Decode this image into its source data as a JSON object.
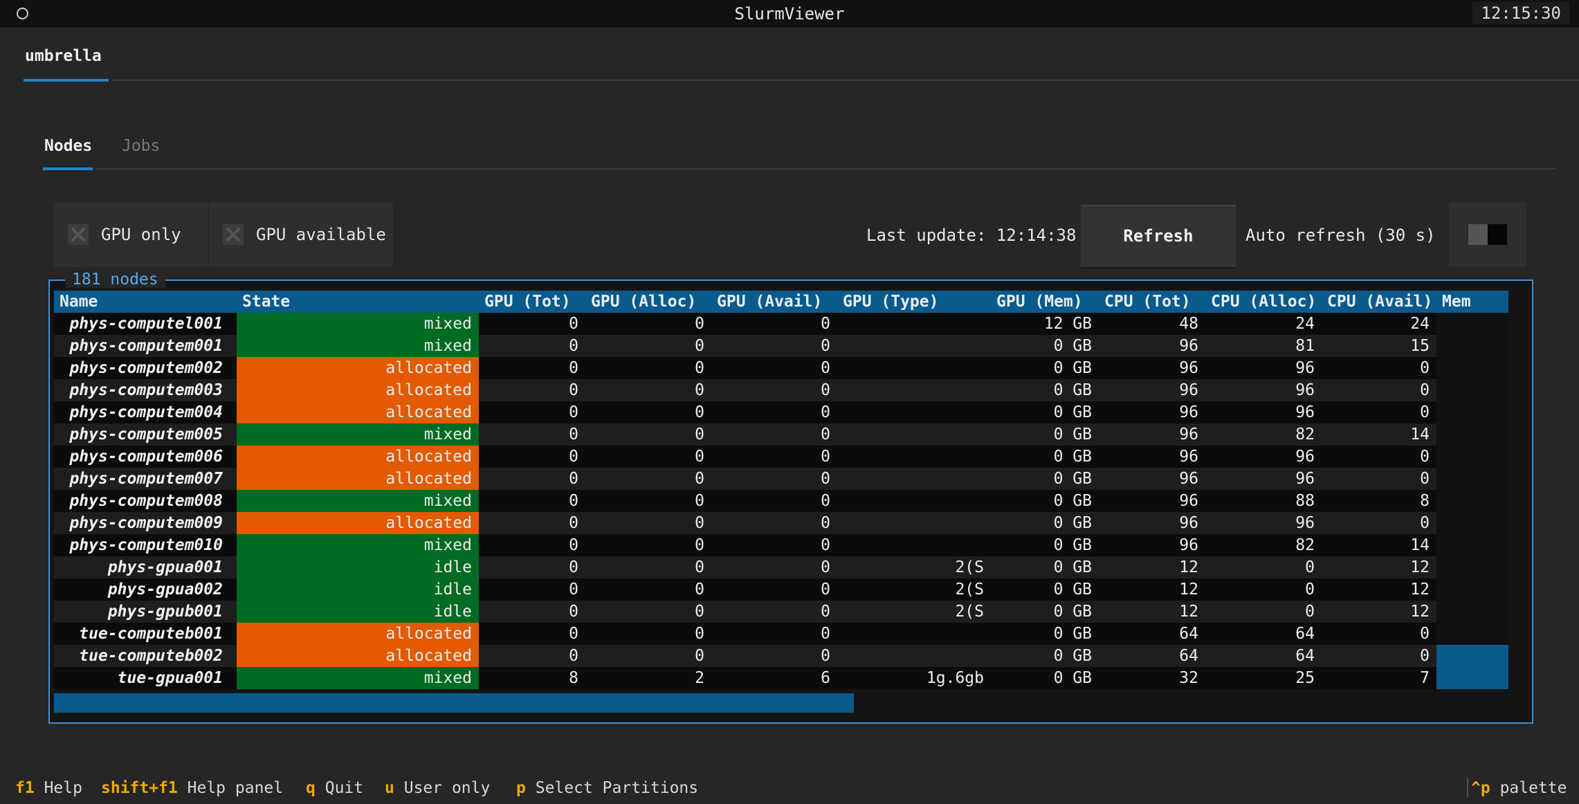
{
  "window": {
    "title": "SlurmViewer",
    "clock": "12:15:30"
  },
  "outer_tab": {
    "label": "umbrella"
  },
  "inner_tabs": [
    {
      "label": "Nodes",
      "active": true
    },
    {
      "label": "Jobs",
      "active": false
    }
  ],
  "toolbar": {
    "gpu_only_label": "GPU only",
    "gpu_available_label": "GPU available",
    "last_update": "Last update: 12:14:38",
    "refresh_label": "Refresh",
    "auto_refresh_label": "Auto refresh (30 s)",
    "auto_refresh_on": false
  },
  "panel": {
    "title": "181 nodes"
  },
  "table": {
    "columns": [
      "Name",
      "State",
      "GPU (Tot)",
      "GPU (Alloc)",
      "GPU (Avail)",
      "GPU (Type)",
      "GPU (Mem)",
      "CPU (Tot)",
      "CPU (Alloc)",
      "CPU (Avail)",
      "Mem"
    ],
    "rows": [
      [
        "phys-computel001",
        "mixed",
        "0",
        "0",
        "0",
        "",
        "12 GB",
        "48",
        "24",
        "24"
      ],
      [
        "phys-computem001",
        "mixed",
        "0",
        "0",
        "0",
        "",
        "0 GB",
        "96",
        "81",
        "15"
      ],
      [
        "phys-computem002",
        "allocated",
        "0",
        "0",
        "0",
        "",
        "0 GB",
        "96",
        "96",
        "0"
      ],
      [
        "phys-computem003",
        "allocated",
        "0",
        "0",
        "0",
        "",
        "0 GB",
        "96",
        "96",
        "0"
      ],
      [
        "phys-computem004",
        "allocated",
        "0",
        "0",
        "0",
        "",
        "0 GB",
        "96",
        "96",
        "0"
      ],
      [
        "phys-computem005",
        "mixed",
        "0",
        "0",
        "0",
        "",
        "0 GB",
        "96",
        "82",
        "14"
      ],
      [
        "phys-computem006",
        "allocated",
        "0",
        "0",
        "0",
        "",
        "0 GB",
        "96",
        "96",
        "0"
      ],
      [
        "phys-computem007",
        "allocated",
        "0",
        "0",
        "0",
        "",
        "0 GB",
        "96",
        "96",
        "0"
      ],
      [
        "phys-computem008",
        "mixed",
        "0",
        "0",
        "0",
        "",
        "0 GB",
        "96",
        "88",
        "8"
      ],
      [
        "phys-computem009",
        "allocated",
        "0",
        "0",
        "0",
        "",
        "0 GB",
        "96",
        "96",
        "0"
      ],
      [
        "phys-computem010",
        "mixed",
        "0",
        "0",
        "0",
        "",
        "0 GB",
        "96",
        "82",
        "14"
      ],
      [
        "phys-gpua001",
        "idle",
        "0",
        "0",
        "0",
        "2(S",
        "0 GB",
        "12",
        "0",
        "12"
      ],
      [
        "phys-gpua002",
        "idle",
        "0",
        "0",
        "0",
        "2(S",
        "0 GB",
        "12",
        "0",
        "12"
      ],
      [
        "phys-gpub001",
        "idle",
        "0",
        "0",
        "0",
        "2(S",
        "0 GB",
        "12",
        "0",
        "12"
      ],
      [
        "tue-computeb001",
        "allocated",
        "0",
        "0",
        "0",
        "",
        "0 GB",
        "64",
        "64",
        "0"
      ],
      [
        "tue-computeb002",
        "allocated",
        "0",
        "0",
        "0",
        "",
        "0 GB",
        "64",
        "64",
        "0"
      ],
      [
        "tue-gpua001",
        "mixed",
        "8",
        "2",
        "6",
        "1g.6gb",
        "0 GB",
        "32",
        "25",
        "7"
      ]
    ]
  },
  "footer": [
    {
      "key": "f1",
      "label": "Help"
    },
    {
      "key": "shift+f1",
      "label": "Help panel"
    },
    {
      "key": "q",
      "label": "Quit"
    },
    {
      "key": "u",
      "label": "User only"
    },
    {
      "key": "p",
      "label": "Select Partitions"
    },
    {
      "key": "^p",
      "label": "palette"
    }
  ],
  "colors": {
    "accent": "#1f86c8",
    "header_bg": "#0a5a8c",
    "mixed": "#006b22",
    "allocated": "#e35a00",
    "key": "#f0a800"
  }
}
